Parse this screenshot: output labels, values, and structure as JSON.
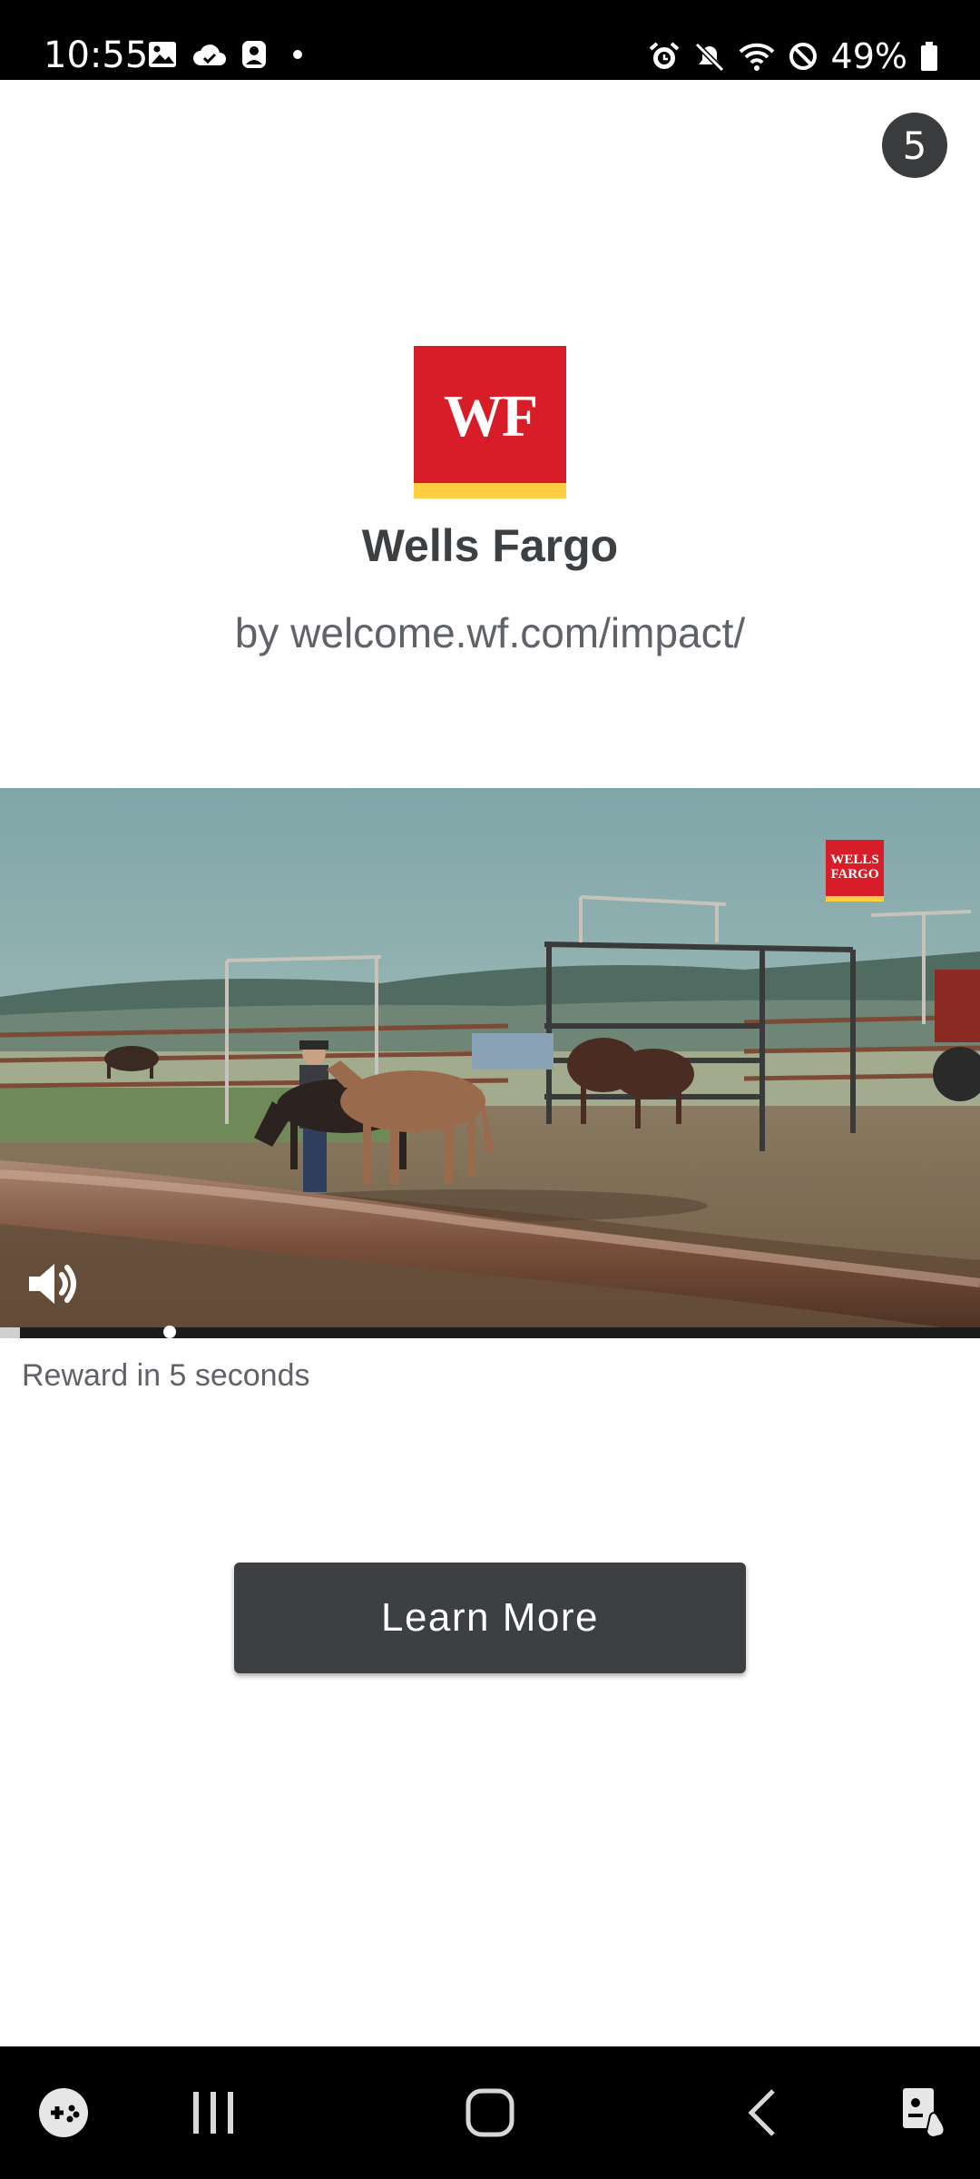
{
  "status_bar": {
    "time": "10:55",
    "battery_percent": "49%",
    "left_icons": [
      "image-icon",
      "cloud-icon",
      "account-icon",
      "dot-icon"
    ],
    "right_icons": [
      "alarm-icon",
      "mute-icon",
      "wifi-icon",
      "dnd-icon",
      "battery-icon"
    ]
  },
  "ad": {
    "countdown": "5",
    "advertiser": {
      "logo_text": "WF",
      "name": "Wells Fargo",
      "url": "by welcome.wf.com/impact/"
    },
    "video": {
      "watermark_text": "WELLS FARGO",
      "muted": false,
      "progress": 0.02,
      "scrubber_position": 0.173
    },
    "reward_text": "Reward in 5 seconds",
    "cta_label": "Learn More",
    "colors": {
      "brand_red": "#d71e28",
      "brand_gold": "#ffcd41",
      "cta_background": "#3c4043"
    }
  },
  "nav_bar": {
    "buttons": [
      "game-launcher-icon",
      "recents-icon",
      "home-icon",
      "back-icon",
      "accessibility-icon"
    ]
  }
}
